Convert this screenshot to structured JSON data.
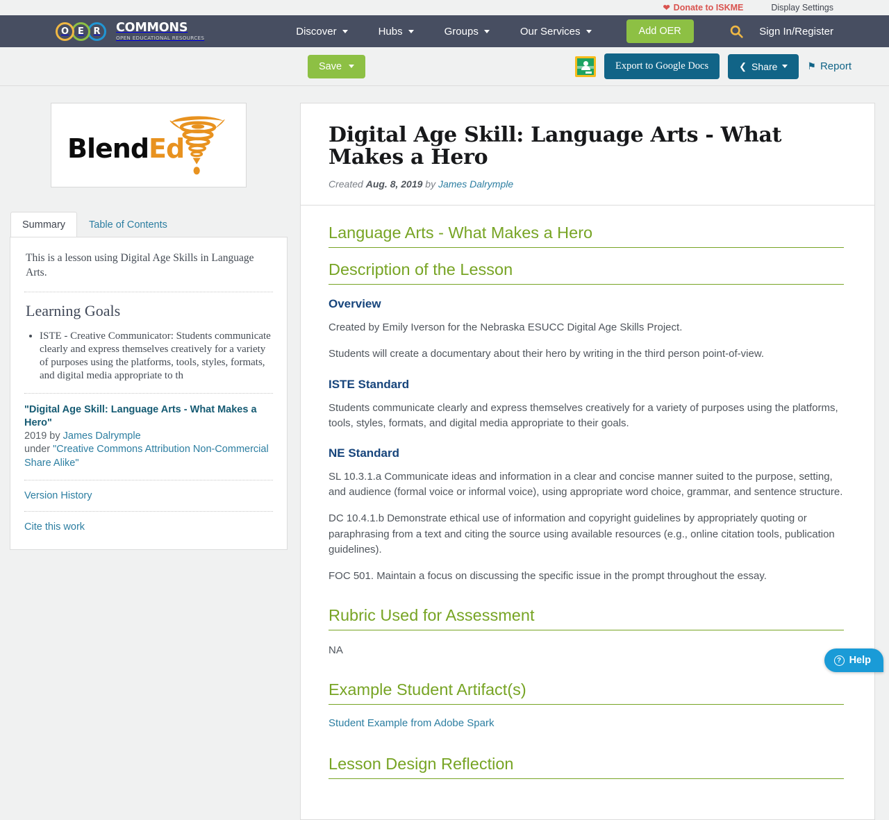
{
  "utility_bar": {
    "donate_label": "Donate to ISKME",
    "display_settings_label": "Display Settings",
    "heart_icon": "heart-icon"
  },
  "nav": {
    "logo": {
      "letters": [
        "O",
        "E",
        "R"
      ],
      "brand": "COMMONS",
      "tagline": "OPEN EDUCATIONAL RESOURCES"
    },
    "items": [
      {
        "label": "Discover",
        "has_caret": true
      },
      {
        "label": "Hubs",
        "has_caret": true
      },
      {
        "label": "Groups",
        "has_caret": true
      },
      {
        "label": "Our Services",
        "has_caret": true
      }
    ],
    "add_oer_label": "Add OER",
    "search_icon": "search-icon",
    "signin_label": "Sign In/Register"
  },
  "action_bar": {
    "save_label": "Save",
    "google_classroom_icon": "google-classroom-icon",
    "export_label": "Export to Google Docs",
    "share_label": "Share",
    "report_label": "Report"
  },
  "sidebar": {
    "thumbnail": {
      "brand_black": "Blend",
      "brand_orange": "Ed",
      "icon": "tornado-icon"
    },
    "tabs": [
      {
        "label": "Summary",
        "active": true
      },
      {
        "label": "Table of Contents",
        "active": false
      }
    ],
    "summary_text": "This is a lesson using Digital Age Skills in Language Arts.",
    "learning_goals_title": "Learning Goals",
    "learning_goals": [
      "ISTE - Creative Communicator: Students communicate clearly and express themselves creatively for a variety of purposes using the platforms, tools, styles, formats, and digital media appropriate to th"
    ],
    "attribution": {
      "title": "\"Digital Age Skill: Language Arts - What Makes a Hero\"",
      "year_by": "2019 by ",
      "author": "James Dalrymple",
      "under": "under ",
      "license": "\"Creative Commons Attribution Non-Commercial Share Alike\""
    },
    "version_history_label": "Version History",
    "cite_label": "Cite this work"
  },
  "main": {
    "title": "Digital Age Skill: Language Arts - What Makes a Hero",
    "byline": {
      "created_label": "Created",
      "date": "Aug. 8, 2019",
      "by_label": "by",
      "author": "James Dalrymple"
    },
    "section1_heading": "Language Arts - What Makes a Hero",
    "section2_heading": "Description of the Lesson",
    "overview_heading": "Overview",
    "overview_p1": "Created by Emily Iverson for the Nebraska ESUCC Digital Age Skills Project.",
    "overview_p2": "Students will create a documentary about their hero by writing in the third person point-of-view.",
    "iste_heading": "ISTE Standard",
    "iste_p1": "Students communicate clearly and express themselves creatively for a variety of purposes using the platforms, tools, styles, formats, and digital media appropriate to their goals.",
    "ne_heading": "NE Standard",
    "ne_p1": "SL 10.3.1.a Communicate ideas and information in a clear and concise manner suited to the purpose, setting, and audience (formal voice or informal voice), using appropriate word choice,  grammar, and sentence structure.",
    "ne_p2": "DC 10.4.1.b Demonstrate ethical use of information and copyright guidelines by appropriately quoting or paraphrasing from a text and citing the source using available resources (e.g., online citation tools, publication guidelines).",
    "ne_p3": "FOC 501. Maintain a focus on discussing the specific issue in the prompt throughout the essay.",
    "rubric_heading": "Rubric Used for Assessment",
    "rubric_text": "NA",
    "artifact_heading": "Example Student Artifact(s)",
    "artifact_link": "Student Example from Adobe Spark",
    "reflection_heading": "Lesson Design Reflection"
  },
  "help_widget": {
    "label": "Help",
    "icon": "question-mark-circle-icon",
    "glyph": "?"
  },
  "colors": {
    "nav_bg": "#474e61",
    "green_accent": "#8dc044",
    "heading_green": "#77a424",
    "blue_button": "#116487",
    "link_blue": "#2c7ea1",
    "navy_heading": "#17457c",
    "donate_red": "#d9534f",
    "page_bg": "#f0f1f1",
    "help_blue": "#1a9bd7"
  }
}
